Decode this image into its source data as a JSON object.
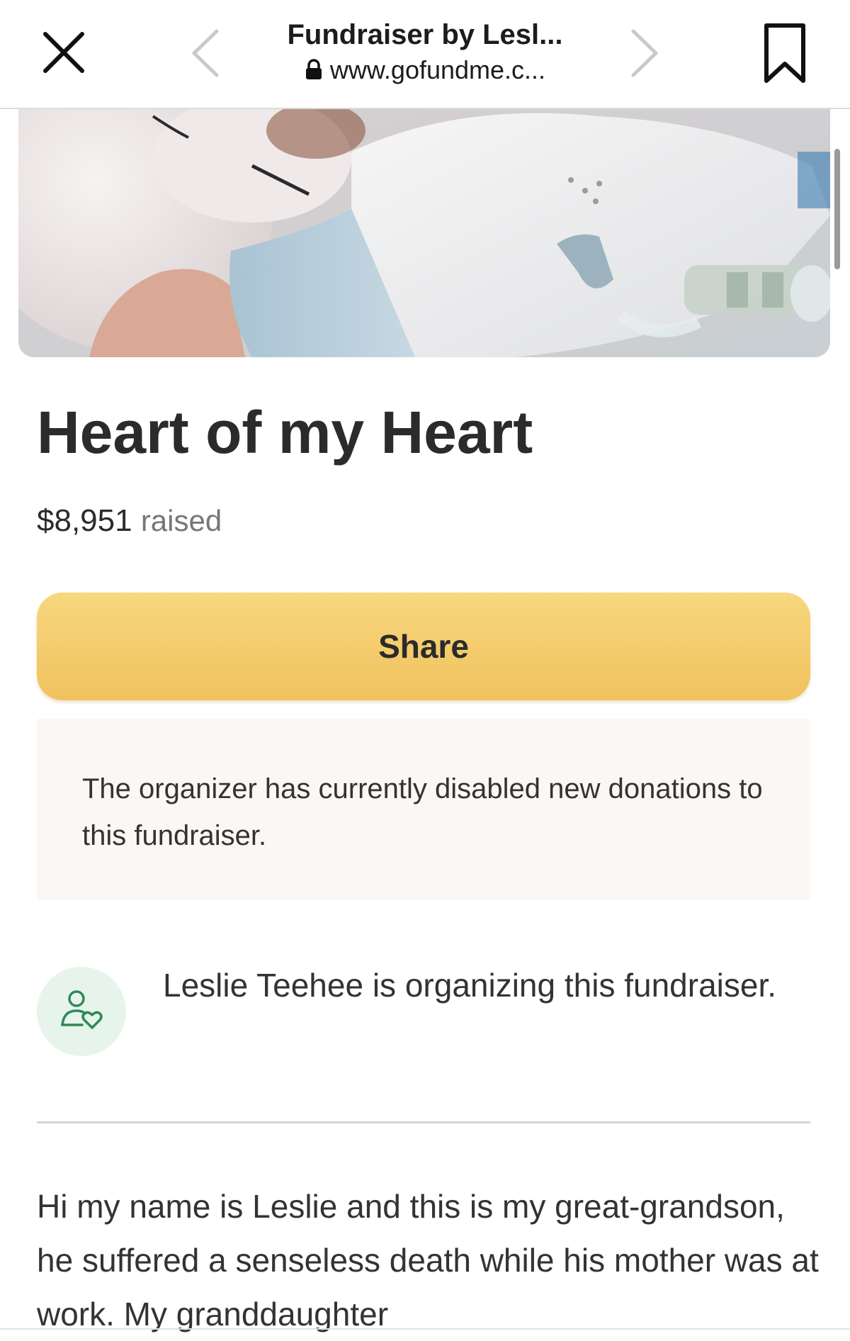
{
  "browser": {
    "title": "Fundraiser by Lesl...",
    "url": "www.gofundme.c...",
    "icons": {
      "close": "close-icon",
      "back": "chevron-left-icon",
      "forward": "chevron-right-icon",
      "bookmark": "bookmark-icon",
      "lock": "lock-icon"
    }
  },
  "fundraiser": {
    "title": "Heart of my Heart",
    "amount": "$8,951",
    "amount_label": "raised",
    "share_label": "Share",
    "notice": "The organizer has currently disabled new donations to this fundraiser.",
    "organizer_text": "Leslie Teehee is organizing this fundraiser.",
    "organizer_icon": "user-heart-icon",
    "story": "Hi my name is Leslie and this is my great-grandson, he suffered a senseless death while his mother was at work. My granddaughter"
  },
  "colors": {
    "share_button": "#f3c862",
    "notice_bg": "#fbf7f5",
    "organizer_icon_bg": "#e7f4ec",
    "organizer_icon_stroke": "#2e8a55"
  }
}
